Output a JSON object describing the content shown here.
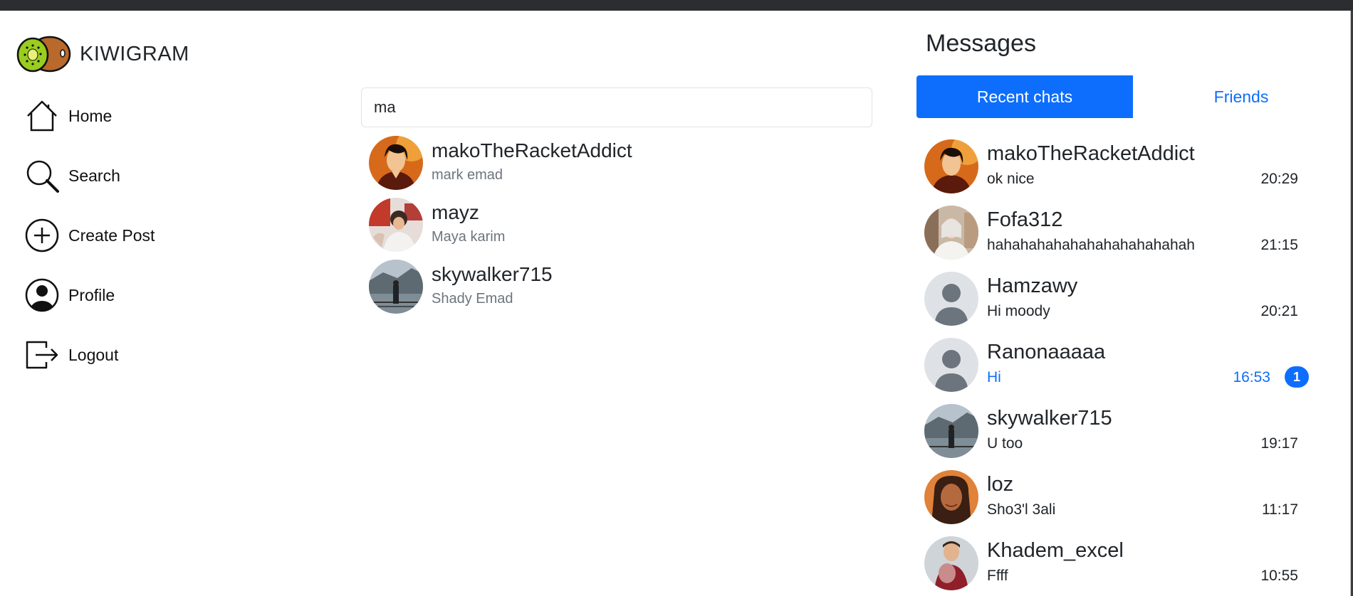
{
  "app": {
    "name": "KIWIGRAM"
  },
  "nav": {
    "home": "Home",
    "search": "Search",
    "create_post": "Create Post",
    "profile": "Profile",
    "logout": "Logout"
  },
  "search": {
    "value": "ma",
    "results": [
      {
        "username": "makoTheRacketAddict",
        "full_name": "mark emad"
      },
      {
        "username": "mayz",
        "full_name": "Maya karim"
      },
      {
        "username": "skywalker715",
        "full_name": "Shady Emad"
      }
    ]
  },
  "messages": {
    "title": "Messages",
    "tabs": {
      "recent": "Recent chats",
      "friends": "Friends"
    },
    "chats": [
      {
        "name": "makoTheRacketAddict",
        "preview": "ok nice",
        "time": "20:29"
      },
      {
        "name": "Fofa312",
        "preview": "hahahahahahahahahahahahah",
        "time": "21:15"
      },
      {
        "name": "Hamzawy",
        "preview": "Hi moody",
        "time": "20:21"
      },
      {
        "name": "Ranonaaaaa",
        "preview": "Hi",
        "time": "16:53",
        "unread": "1"
      },
      {
        "name": "skywalker715",
        "preview": "U too",
        "time": "19:17"
      },
      {
        "name": "loz",
        "preview": "Sho3'l 3ali",
        "time": "11:17"
      },
      {
        "name": "Khadem_excel",
        "preview": "Ffff",
        "time": "10:55"
      }
    ]
  },
  "colors": {
    "accent": "#0d6efd",
    "muted_text": "#6c757d",
    "kiwi_green": "#9acd1f",
    "kiwi_brown": "#b8692b"
  }
}
